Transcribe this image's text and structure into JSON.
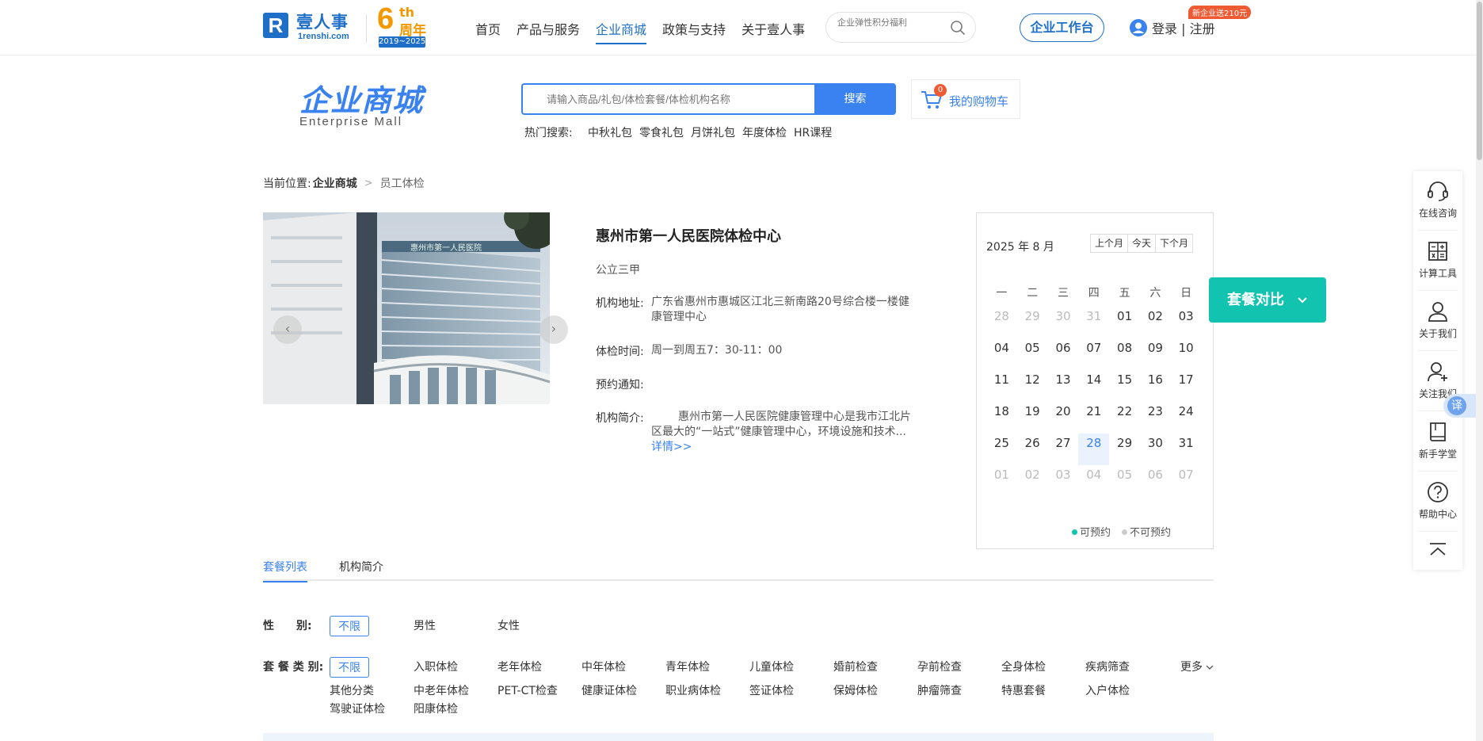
{
  "header": {
    "logo_mark": "R",
    "logo_cn": "壹人事",
    "logo_en": "1renshi.com",
    "anniv_num": "6",
    "anniv_th": "th",
    "anniv_cn": "周年",
    "anniv_years": "2019~2025",
    "nav": [
      "首页",
      "产品与服务",
      "企业商城",
      "政策与支持",
      "关于壹人事"
    ],
    "active_nav": "企业商城",
    "search_placeholder": "企业弹性积分福利",
    "workbench": "企业工作台",
    "login": "登录 | 注册",
    "promo_badge": "新企业送210元"
  },
  "mall": {
    "title": "企业商城",
    "subtitle": "Enterprise  Mall",
    "search_placeholder": "请输入商品/礼包/体检套餐/体检机构名称",
    "search_button": "搜索",
    "cart_count": "0",
    "cart_label": "我的购物车",
    "hot_label": "热门搜索:",
    "hot_items": [
      "中秋礼包",
      "零食礼包",
      "月饼礼包",
      "年度体检",
      "HR课程"
    ]
  },
  "breadcrumb": {
    "prefix": "当前位置:",
    "level1": "企业商城",
    "level2": "员工体检"
  },
  "hospital": {
    "name": "惠州市第一人民医院体检中心",
    "grade": "公立三甲",
    "address_label": "机构地址:",
    "address_line1": "广东省惠州市惠城区江北三新南路20号综合楼一楼健",
    "address_line2": "康管理中心",
    "hours_label": "体检时间:",
    "hours": "周一到周五7：30-11：00",
    "notice_label": "预约通知:",
    "intro_label": "机构简介:",
    "intro_line1": "惠州市第一人民医院健康管理中心是我市江北片",
    "intro_line2": "区最大的“一站式”健康管理中心，环境设施和技术...",
    "more": "详情>>",
    "photo_sign": "惠州市第一人民医院"
  },
  "calendar": {
    "title": "2025 年 8 月",
    "buttons": [
      "上个月",
      "今天",
      "下个月"
    ],
    "weekdays": [
      "一",
      "二",
      "三",
      "四",
      "五",
      "六",
      "日"
    ],
    "days": [
      {
        "d": "28",
        "out": true
      },
      {
        "d": "29",
        "out": true
      },
      {
        "d": "30",
        "out": true
      },
      {
        "d": "31",
        "out": true
      },
      {
        "d": "01"
      },
      {
        "d": "02"
      },
      {
        "d": "03"
      },
      {
        "d": "04"
      },
      {
        "d": "05"
      },
      {
        "d": "06"
      },
      {
        "d": "07"
      },
      {
        "d": "08"
      },
      {
        "d": "09"
      },
      {
        "d": "10"
      },
      {
        "d": "11"
      },
      {
        "d": "12"
      },
      {
        "d": "13"
      },
      {
        "d": "14"
      },
      {
        "d": "15"
      },
      {
        "d": "16"
      },
      {
        "d": "17"
      },
      {
        "d": "18"
      },
      {
        "d": "19"
      },
      {
        "d": "20"
      },
      {
        "d": "21"
      },
      {
        "d": "22"
      },
      {
        "d": "23"
      },
      {
        "d": "24"
      },
      {
        "d": "25"
      },
      {
        "d": "26"
      },
      {
        "d": "27"
      },
      {
        "d": "28",
        "today": true
      },
      {
        "d": "29"
      },
      {
        "d": "30"
      },
      {
        "d": "31"
      },
      {
        "d": "01",
        "out": true
      },
      {
        "d": "02",
        "out": true
      },
      {
        "d": "03",
        "out": true
      },
      {
        "d": "04",
        "out": true
      },
      {
        "d": "05",
        "out": true
      },
      {
        "d": "06",
        "out": true
      },
      {
        "d": "07",
        "out": true
      }
    ],
    "legend_available": "可预约",
    "legend_unavailable": "不可预约",
    "color_available": "#12c3b0",
    "color_unavailable": "#cccccc"
  },
  "compare": {
    "label": "套餐对比"
  },
  "tabs": [
    "套餐列表",
    "机构简介"
  ],
  "filters": {
    "gender_label": "性　　别:",
    "gender_options": [
      "不限",
      "男性",
      "女性"
    ],
    "type_label": "套 餐 类 别:",
    "type_row1": [
      "不限",
      "入职体检",
      "老年体检",
      "中年体检",
      "青年体检",
      "儿童体检",
      "婚前检查",
      "孕前检查",
      "全身体检",
      "疾病筛查"
    ],
    "type_row2": [
      "其他分类",
      "中老年体检",
      "PET-CT检查",
      "健康证体检",
      "职业病体检",
      "签证体检",
      "保姆体检",
      "肿瘤筛查",
      "特惠套餐",
      "入户体检"
    ],
    "type_row3": [
      "驾驶证体检",
      "阳康体检"
    ],
    "more": "更多"
  },
  "sidebar": [
    "在线咨询",
    "计算工具",
    "关于我们",
    "关注我们",
    "新手学堂",
    "帮助中心"
  ],
  "translate": "译",
  "colors": {
    "brand": "#1f6fc8",
    "accent": "#3a82f0",
    "teal": "#12c3b0",
    "anniversary": "#f39800"
  }
}
